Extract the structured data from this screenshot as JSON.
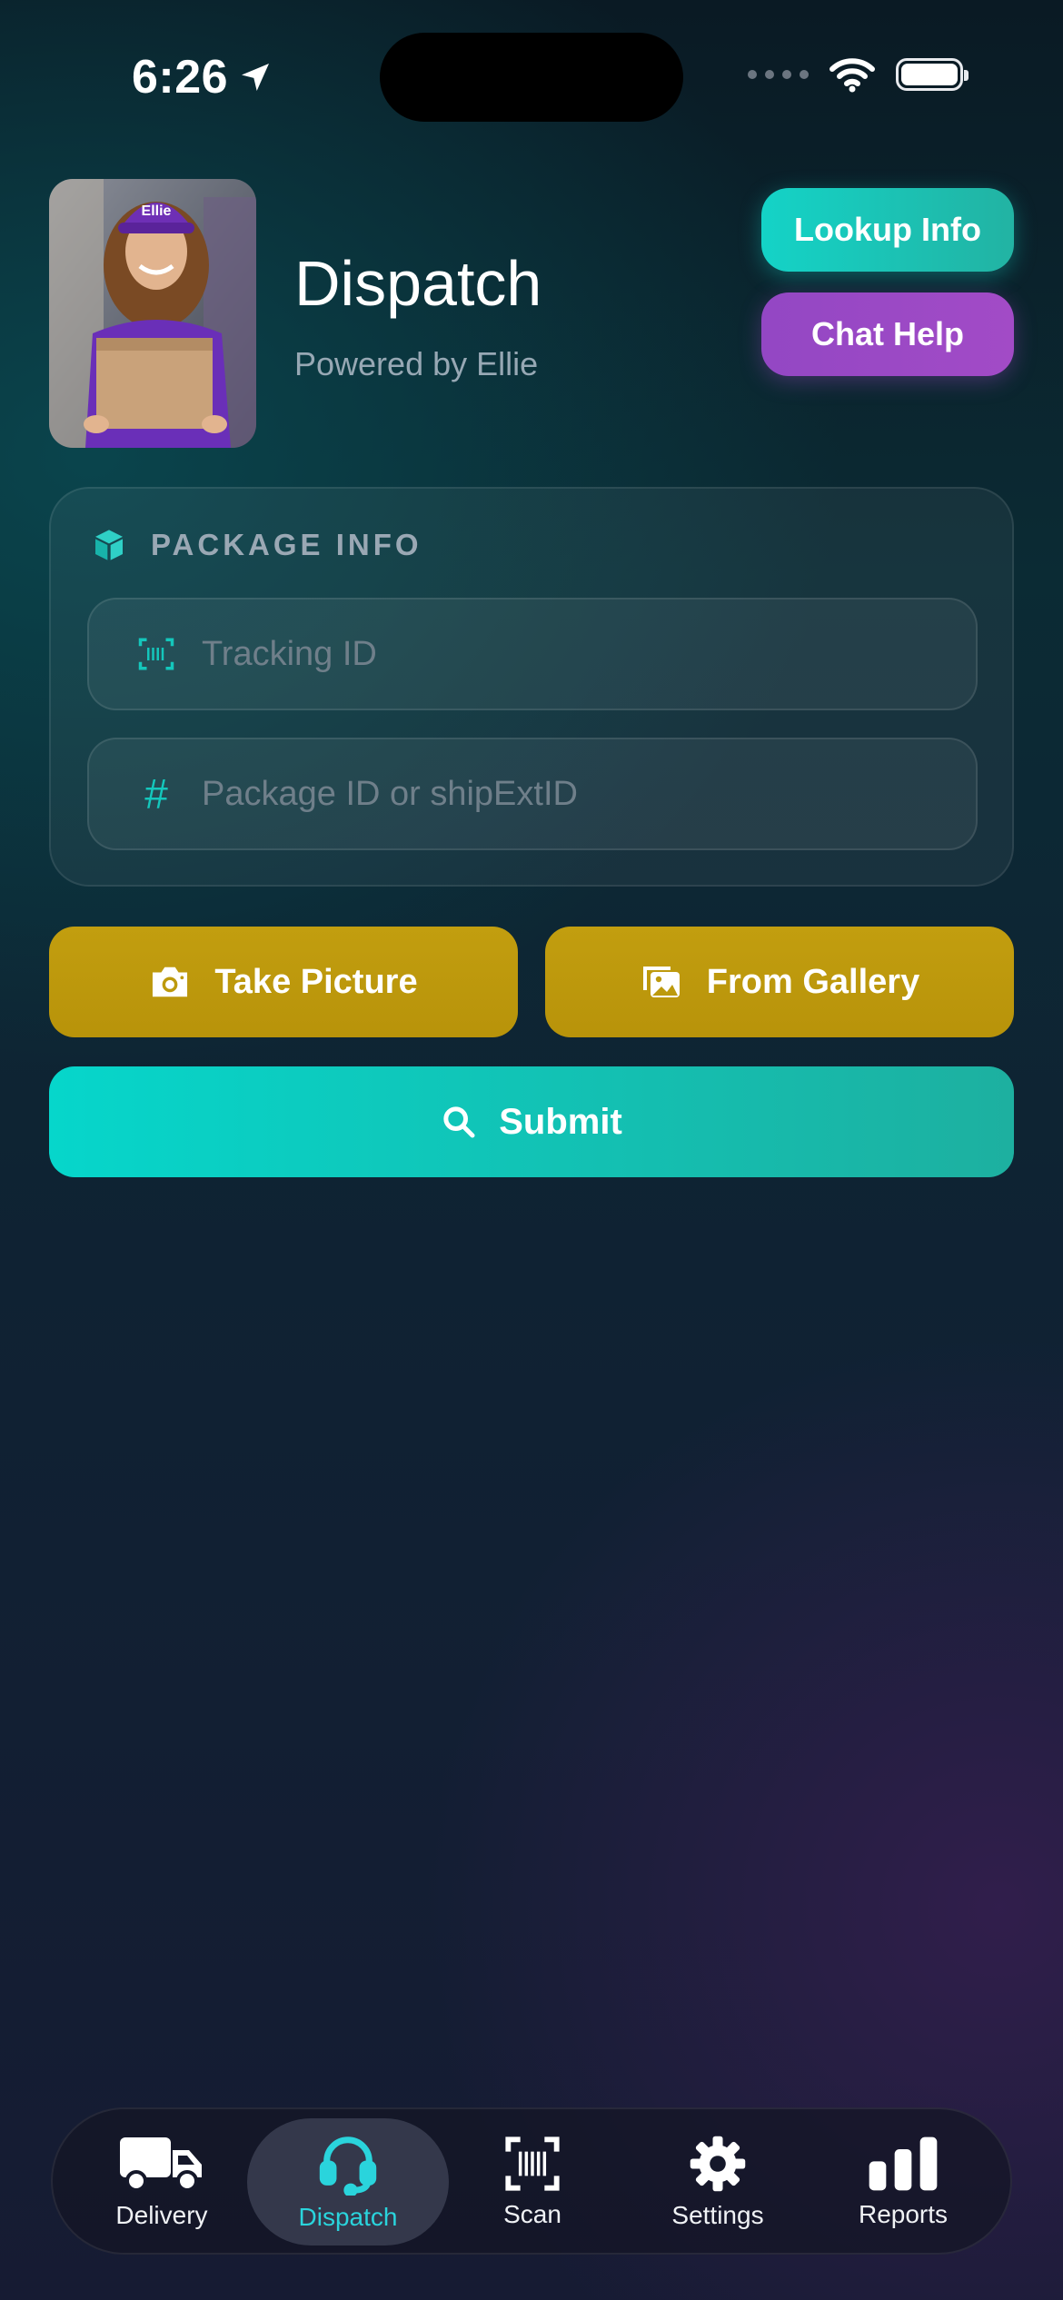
{
  "status_bar": {
    "time": "6:26"
  },
  "header": {
    "title": "Dispatch",
    "subtitle": "Powered by Ellie",
    "lookup_label": "Lookup Info",
    "chat_label": "Chat Help",
    "avatar_cap_text": "Ellie"
  },
  "package_card": {
    "title": "PACKAGE INFO",
    "tracking_placeholder": "Tracking ID",
    "package_placeholder": "Package ID or shipExtID",
    "package_field_icon": "#"
  },
  "actions": {
    "take_picture": "Take Picture",
    "from_gallery": "From Gallery",
    "submit": "Submit"
  },
  "tabbar": {
    "items": [
      {
        "label": "Delivery",
        "icon": "truck-icon"
      },
      {
        "label": "Dispatch",
        "icon": "headset-icon",
        "active": true
      },
      {
        "label": "Scan",
        "icon": "barcode-scan-icon"
      },
      {
        "label": "Settings",
        "icon": "gear-icon"
      },
      {
        "label": "Reports",
        "icon": "bar-chart-icon"
      }
    ]
  },
  "colors": {
    "accent_teal": "#14d3c7",
    "accent_purple": "#9a49c5",
    "accent_gold": "#bd9a0d",
    "active_tab": "#2ad4dc"
  }
}
